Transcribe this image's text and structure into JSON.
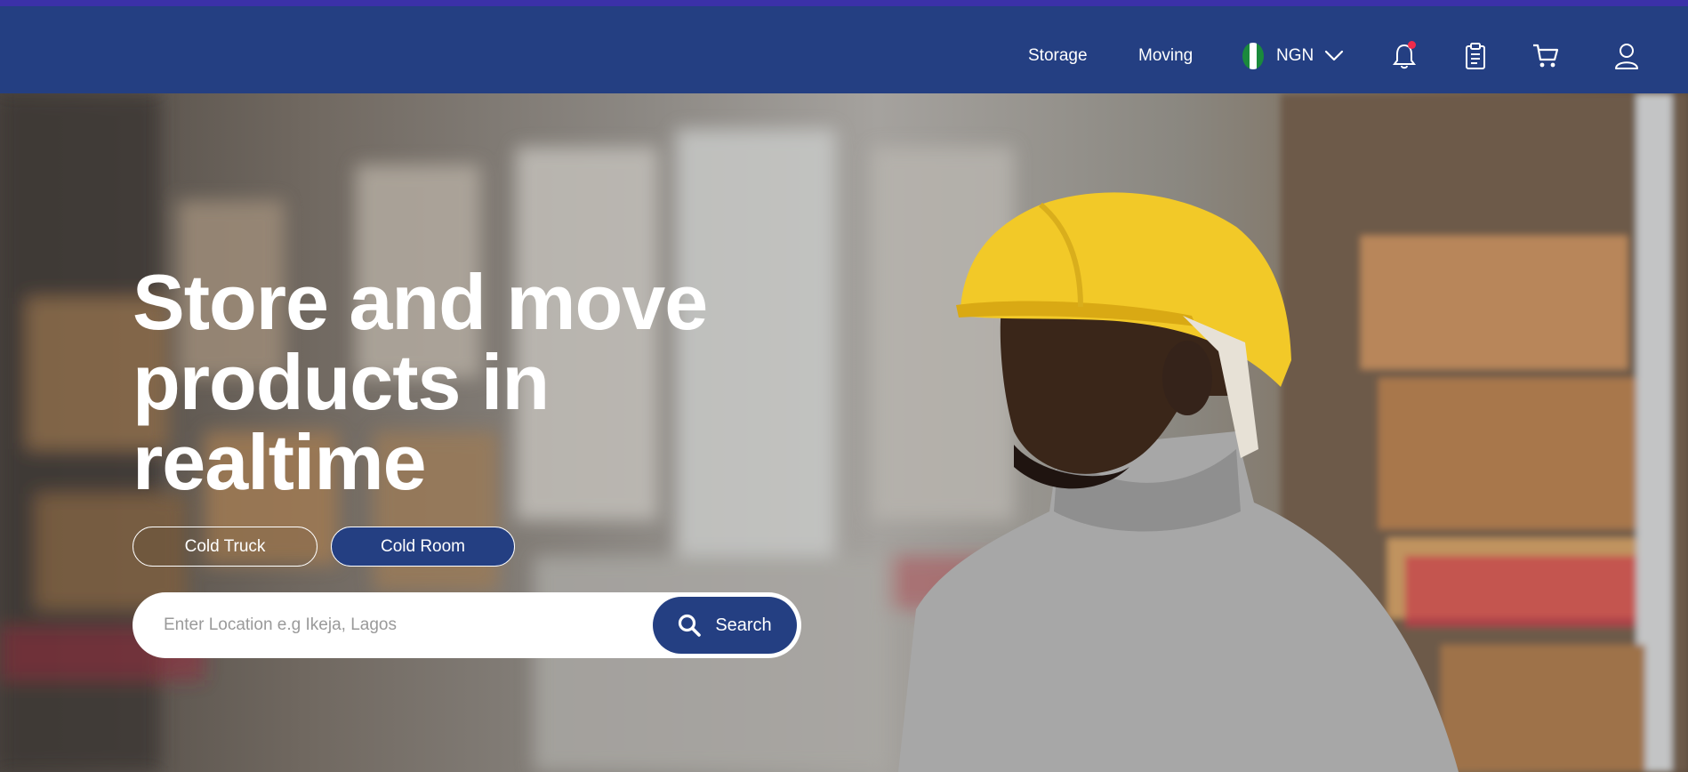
{
  "nav": {
    "links": [
      "Storage",
      "Moving"
    ],
    "currency": "NGN",
    "icons": [
      "bell-icon",
      "clipboard-icon",
      "cart-icon",
      "user-icon"
    ]
  },
  "hero": {
    "title_lines": [
      "Store and move",
      "products in",
      "realtime"
    ],
    "pills": [
      "Cold Truck",
      "Cold Room"
    ],
    "search": {
      "placeholder": "Enter Location e.g Ikeja, Lagos",
      "button_label": "Search"
    }
  },
  "colors": {
    "brand": "#243f82",
    "top_strip": "#3b31a8",
    "notification": "#ef2b4b",
    "flag_green": "#1a8a3c"
  }
}
